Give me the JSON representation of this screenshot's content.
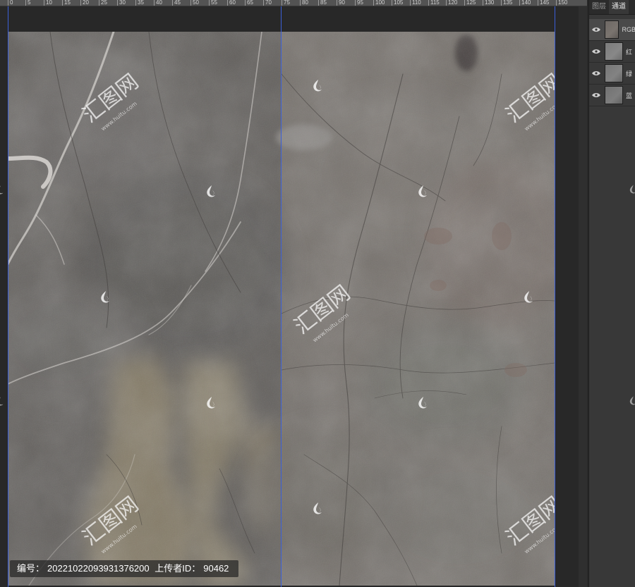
{
  "ruler": {
    "ticks": [
      "0",
      "5",
      "10",
      "15",
      "20",
      "25",
      "30",
      "35",
      "40",
      "45",
      "50",
      "55",
      "60",
      "65",
      "70",
      "75",
      "80",
      "85",
      "90",
      "95",
      "100",
      "105",
      "110",
      "115",
      "120",
      "125",
      "130",
      "135",
      "140",
      "145",
      "150"
    ]
  },
  "canvas": {
    "info_label": "编号：",
    "info_id": "20221022093931376200",
    "uploader_label": "上传者ID：",
    "uploader_id": "90462",
    "watermark_text": "汇图网",
    "watermark_url": "www.huitu.com"
  },
  "panel": {
    "tabs": [
      {
        "label": "图层",
        "active": false
      },
      {
        "label": "通道",
        "active": true
      }
    ],
    "channels": [
      {
        "label": "RGB",
        "selected": true
      },
      {
        "label": "红",
        "selected": false
      },
      {
        "label": "绿",
        "selected": false
      },
      {
        "label": "蓝",
        "selected": false
      }
    ]
  },
  "colors": {
    "marble_base": "#6e6b68",
    "guide": "#3b5fd8",
    "panel_bg": "#383838"
  }
}
